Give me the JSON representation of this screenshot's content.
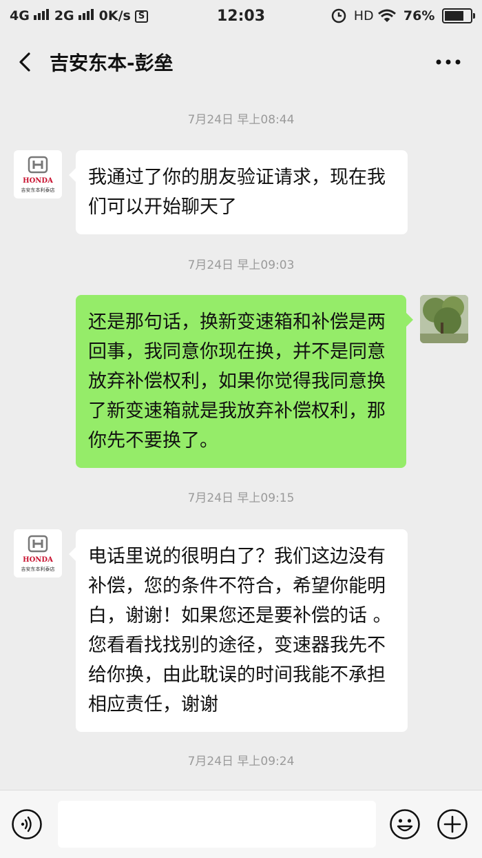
{
  "status_bar": {
    "net1": "4G",
    "net2": "2G",
    "speed": "0K/s",
    "s_badge": "S",
    "time": "12:03",
    "hd": "HD",
    "battery_text": "76%",
    "battery_level": 0.76
  },
  "header": {
    "title": "吉安东本-彭垒",
    "back_icon": "chevron-left-icon",
    "more_icon": "more-dots-icon"
  },
  "avatar_logo": {
    "brand": "HONDA",
    "dealer": "吉安东本利泰店"
  },
  "messages": [
    {
      "time": "7月24日 早上08:44",
      "from": "them",
      "text": "我通过了你的朋友验证请求，现在我们可以开始聊天了"
    },
    {
      "time": "7月24日 早上09:03",
      "from": "me",
      "text": "还是那句话，换新变速箱和补偿是两回事，我同意你现在换，并不是同意放弃补偿权利，如果你觉得我同意换了新变速箱就是我放弃补偿权利，那你先不要换了。"
    },
    {
      "time": "7月24日 早上09:15",
      "from": "them",
      "text": "电话里说的很明白了？我们这边没有补偿，您的条件不符合，希望你能明白，谢谢！如果您还是要补偿的话 。您看看找找别的途径，变速器我先不给你换，由此耽误的时间我能不承担相应责任，谢谢"
    }
  ],
  "last_time": "7月24日 早上09:24",
  "input_bar": {
    "voice_icon": "voice-icon",
    "emoji_icon": "emoji-icon",
    "plus_icon": "plus-icon",
    "text_value": ""
  },
  "colors": {
    "background": "#ededed",
    "bubble_me": "#95ec69",
    "bubble_them": "#ffffff",
    "timestamp": "#9a9a9a",
    "honda_red": "#c8102e"
  }
}
